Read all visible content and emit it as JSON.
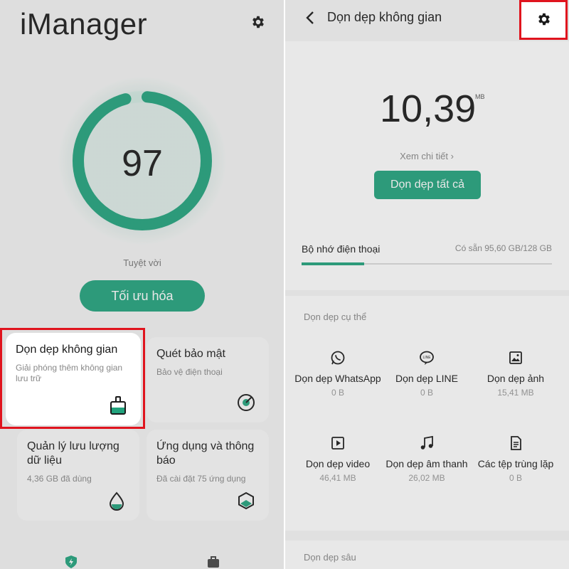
{
  "left": {
    "app_title": "iManager",
    "score": "97",
    "score_label": "Tuyệt vời",
    "score_progress": 0.97,
    "optimize_button": "Tối ưu hóa",
    "cards": [
      {
        "title": "Dọn dẹp không gian",
        "subtitle": "Giải phóng thêm không gian lưu trữ",
        "icon": "broom-icon"
      },
      {
        "title": "Quét bảo mật",
        "subtitle": "Bảo vệ điện thoại",
        "icon": "radar-icon"
      },
      {
        "title": "Quản lý lưu lượng dữ liệu",
        "subtitle": "4,36 GB đã dùng",
        "icon": "drop-icon"
      },
      {
        "title": "Ứng dụng và thông báo",
        "subtitle": "Đã cài đặt 75 ứng dụng",
        "icon": "hexagon-icon"
      }
    ],
    "bottom_nav": [
      "shield-bolt-icon",
      "toolbox-icon"
    ]
  },
  "right": {
    "title": "Dọn dẹp không gian",
    "size_value": "10,39",
    "size_unit": "MB",
    "see_detail": "Xem chi tiết ›",
    "clean_all_button": "Dọn dẹp tất cả",
    "memory_label": "Bộ nhớ điện thoại",
    "memory_available": "Có sẵn 95,60 GB/128 GB",
    "memory_used_fraction": 0.25,
    "section_title": "Dọn dẹp cụ thể",
    "items": [
      {
        "label": "Dọn dẹp WhatsApp",
        "size": "0 B",
        "icon": "whatsapp-icon"
      },
      {
        "label": "Dọn dẹp LINE",
        "size": "0 B",
        "icon": "line-icon"
      },
      {
        "label": "Dọn dẹp ảnh",
        "size": "15,41 MB",
        "icon": "image-icon"
      },
      {
        "label": "Dọn dẹp video",
        "size": "46,41 MB",
        "icon": "video-icon"
      },
      {
        "label": "Dọn dẹp âm thanh",
        "size": "26,02 MB",
        "icon": "music-icon"
      },
      {
        "label": "Các tệp trùng lặp",
        "size": "0 B",
        "icon": "duplicate-file-icon"
      }
    ],
    "deep_section_title": "Dọn dẹp sâu"
  },
  "colors": {
    "accent": "#21a27c",
    "highlight": "#e0141e"
  }
}
